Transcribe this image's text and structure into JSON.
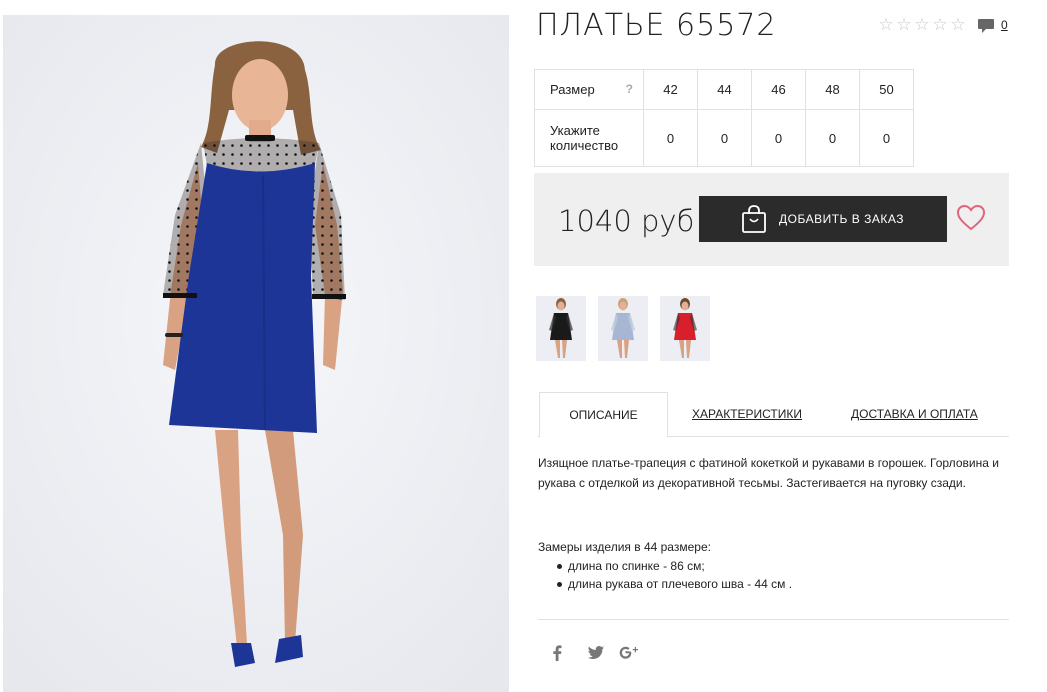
{
  "product": {
    "title": "ПЛАТЬЕ 65572",
    "comments_count": "0"
  },
  "rating": {
    "stars": [
      "☆",
      "☆",
      "☆",
      "☆",
      "☆"
    ],
    "value": 0
  },
  "icons": {
    "rating": "star-outline-icon",
    "comments": "speech-bubble-icon",
    "help": "question-icon",
    "cart": "shopping-bag-icon",
    "favorite": "heart-outline-icon",
    "social": [
      "facebook-icon",
      "twitter-icon",
      "google-plus-icon"
    ]
  },
  "size_table": {
    "size_label": "Размер",
    "help": "?",
    "sizes": [
      "42",
      "44",
      "46",
      "48",
      "50"
    ],
    "qty_label": "Укажите количество",
    "quantities": [
      "0",
      "0",
      "0",
      "0",
      "0"
    ]
  },
  "price": {
    "value": "1040 руб",
    "add_button": "ДОБАВИТЬ В ЗАКАЗ"
  },
  "colors": {
    "dress_main": "#1c3597",
    "heart": "#e0657a",
    "button_bg": "#2b2b2b",
    "variants": [
      "#1a1a1a",
      "#a7b7d3",
      "#d7202b"
    ]
  },
  "tabs": [
    {
      "label": "ОПИСАНИЕ",
      "active": true
    },
    {
      "label": "ХАРАКТЕРИСТИКИ",
      "active": false
    },
    {
      "label": "ДОСТАВКА И ОПЛАТА",
      "active": false
    }
  ],
  "description": {
    "text": "Изящное платье-трапеция с фатиной кокеткой и рукавами в горошек. Горловина и рукава с отделкой из декоративной тесьмы. Застегивается на пуговку сзади.",
    "measures_title": "Замеры изделия в 44 размере:",
    "measures": [
      "длина по спинке - 86 см;",
      "длина рукава от плечевого шва - 44 см ."
    ]
  },
  "social": [
    "f",
    "t",
    "g+"
  ]
}
